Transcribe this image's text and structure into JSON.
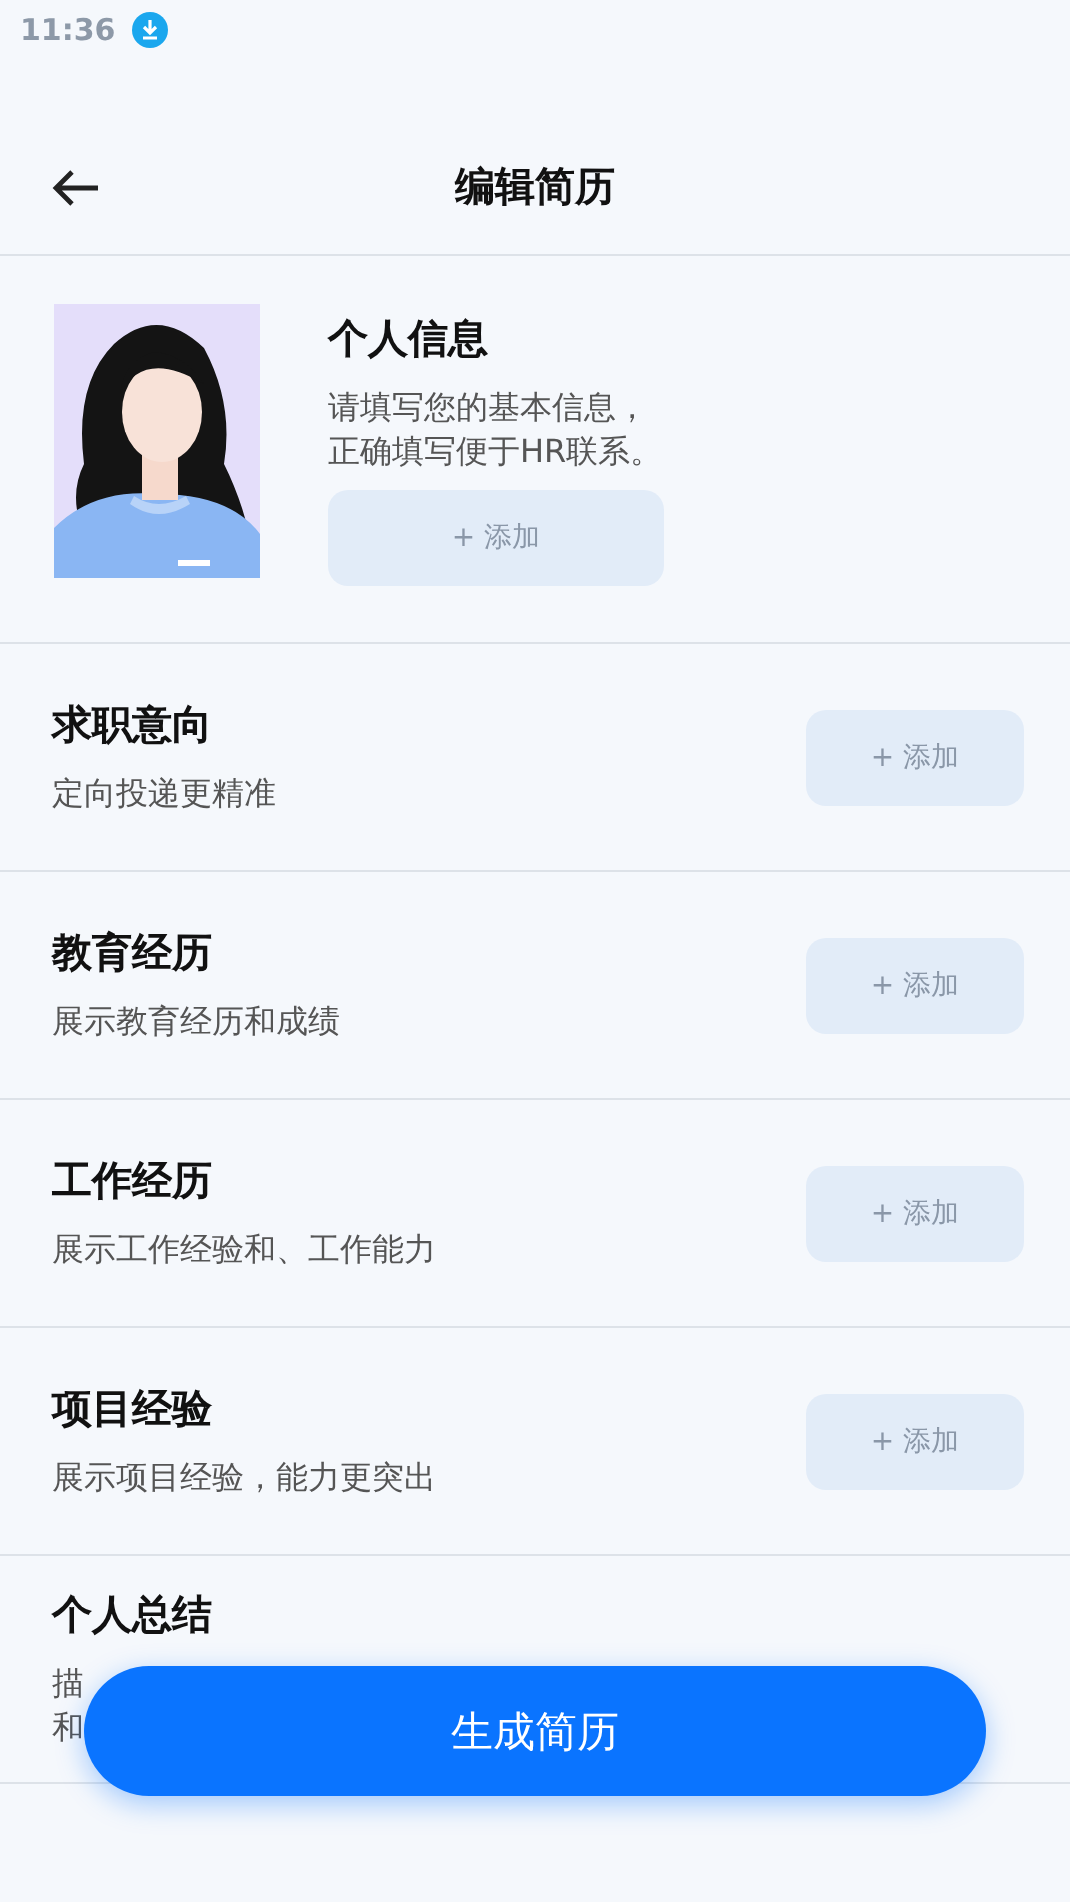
{
  "status_bar": {
    "time": "11:36"
  },
  "header": {
    "title": "编辑简历"
  },
  "profile": {
    "title": "个人信息",
    "lines": [
      "请填写您的基本信息，",
      "正确填写便于HR联系。"
    ],
    "button": "+ 添加"
  },
  "sections": [
    {
      "title": "求职意向",
      "lines": [
        "定向投递更精准"
      ],
      "button": "+ 添加"
    },
    {
      "title": "教育经历",
      "lines": [
        "展示教育经历和成绩"
      ],
      "button": "+ 添加"
    },
    {
      "title": "工作经历",
      "lines": [
        "展示工作经验和、工作能力"
      ],
      "button": "+ 添加"
    },
    {
      "title": "项目经验",
      "lines": [
        "展示项目经验，能力更突出"
      ],
      "button": "+ 添加"
    },
    {
      "title": "个人总结",
      "lines": [
        "描",
        "和"
      ]
    }
  ],
  "generate_button": "生成简历"
}
